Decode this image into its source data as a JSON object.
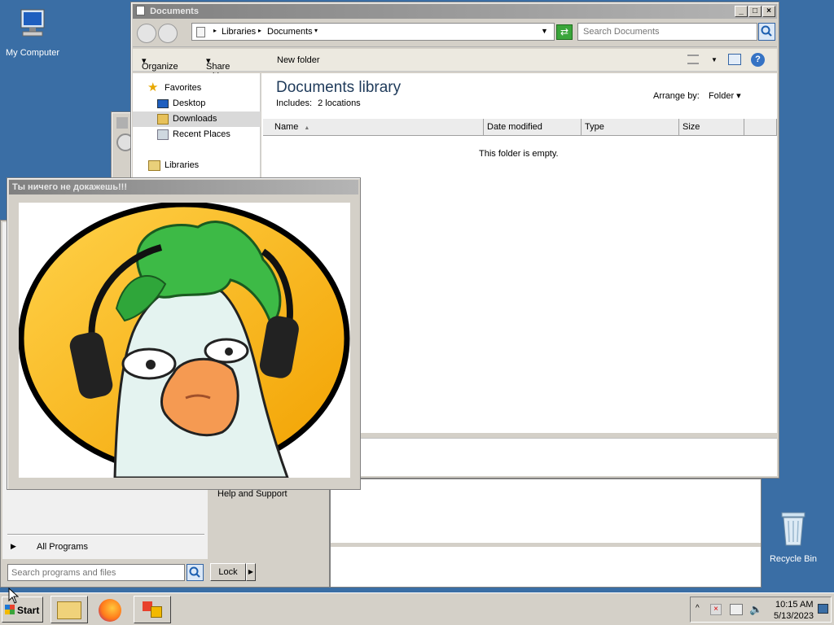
{
  "desktop": {
    "my_computer_label": "My Computer",
    "recycle_bin_label": "Recycle Bin"
  },
  "explorer": {
    "title": "Documents",
    "breadcrumb": [
      "Libraries",
      "Documents"
    ],
    "search_placeholder": "Search Documents",
    "commands": {
      "organize": "Organize",
      "share_with": "Share with",
      "new_folder": "New folder"
    },
    "nav": {
      "favorites": "Favorites",
      "desktop": "Desktop",
      "downloads": "Downloads",
      "recent_places": "Recent Places",
      "libraries": "Libraries"
    },
    "library_title": "Documents library",
    "includes_label": "Includes:",
    "includes_value": "2 locations",
    "arrange_by_label": "Arrange by:",
    "arrange_by_value": "Folder",
    "columns": [
      "Name",
      "Date modified",
      "Type",
      "Size"
    ],
    "empty_message": "This folder is empty."
  },
  "start_menu": {
    "help_and_support": "Help and Support",
    "all_programs": "All Programs",
    "search_placeholder": "Search programs and files",
    "lock_label": "Lock"
  },
  "popup": {
    "title": "Ты ничего не докажешь!!!"
  },
  "taskbar": {
    "start_label": "Start",
    "time": "10:15 AM",
    "date": "5/13/2023"
  },
  "colors": {
    "desktop": "#3a6ea5",
    "accent": "#1c5fb0",
    "image_orange": "#f5a400",
    "image_green": "#2fa63a"
  }
}
